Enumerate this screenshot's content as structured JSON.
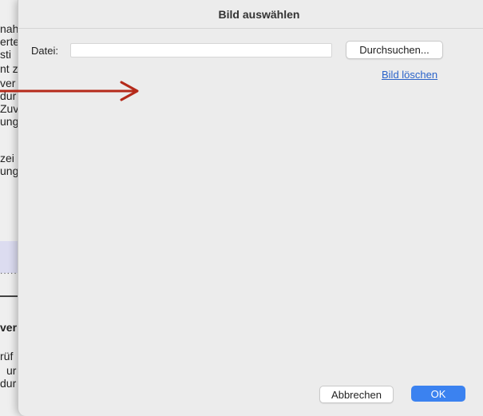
{
  "background_document": {
    "lines": [
      "nah",
      "erte",
      "sti",
      "nt z",
      "ver",
      "dur",
      "Zuv",
      "ung",
      "zei",
      "ung",
      "ver",
      "rüf",
      "ur",
      "dur"
    ],
    "dots": "....."
  },
  "dialog": {
    "title": "Bild auswählen",
    "file_label": "Datei:",
    "file_value": "",
    "browse_label": "Durchsuchen...",
    "delete_link": "Bild löschen",
    "cancel_label": "Abbrechen",
    "ok_label": "OK"
  },
  "colors": {
    "accent": "#3b82f0",
    "link": "#2a63c9",
    "annotation_arrow": "#b52a1a"
  },
  "icons": {
    "annotation": "arrow-right-icon"
  }
}
